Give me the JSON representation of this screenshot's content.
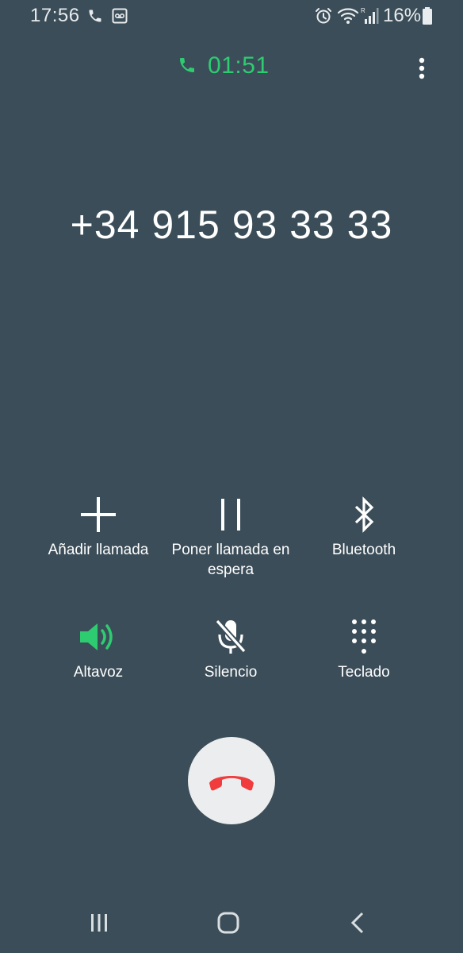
{
  "status_bar": {
    "time": "17:56",
    "battery": "16%",
    "icons": [
      "phone-icon",
      "voicemail-icon",
      "alarm-icon",
      "wifi-icon",
      "signal-icon",
      "battery-icon"
    ]
  },
  "call": {
    "timer": "01:51",
    "number": "+34 915 93 33 33"
  },
  "actions": [
    {
      "label": "Añadir llamada",
      "icon": "add-call-icon"
    },
    {
      "label": "Poner llamada en espera",
      "icon": "hold-icon"
    },
    {
      "label": "Bluetooth",
      "icon": "bluetooth-icon"
    },
    {
      "label": "Altavoz",
      "icon": "speaker-icon"
    },
    {
      "label": "Silencio",
      "icon": "mute-icon"
    },
    {
      "label": "Teclado",
      "icon": "keypad-icon"
    }
  ],
  "colors": {
    "background": "#3b4d58",
    "accent_green": "#2ecc71",
    "end_call_red": "#f03c3c",
    "end_button_bg": "#ecedee"
  },
  "nav": {
    "items": [
      "recents-icon",
      "home-icon",
      "back-icon"
    ]
  }
}
